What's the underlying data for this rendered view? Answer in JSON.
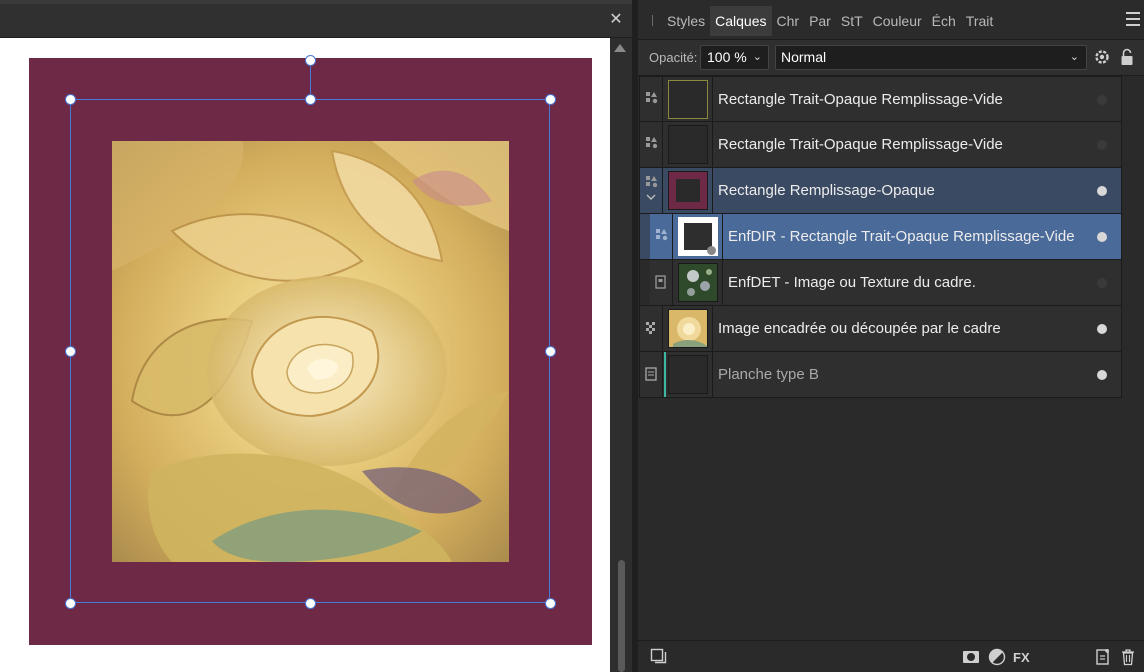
{
  "document": {
    "close_glyph": "✕",
    "frame_color": "#6e2947",
    "selection_color": "#4a78d8"
  },
  "panel": {
    "tabs": [
      {
        "label": "Styles"
      },
      {
        "label": "Calques"
      },
      {
        "label": "Chr"
      },
      {
        "label": "Par"
      },
      {
        "label": "StT"
      },
      {
        "label": "Couleur"
      },
      {
        "label": "Éch"
      },
      {
        "label": "Trait"
      }
    ],
    "active_tab": "Calques",
    "opacity_label": "Opacité:",
    "opacity_value": "100 %",
    "blend_mode": "Normal"
  },
  "layers": [
    {
      "name": "Rectangle Trait-Opaque Remplissage-Vide",
      "icon": "shape-icon",
      "visible": false,
      "selected": false,
      "child": false
    },
    {
      "name": "Rectangle Trait-Opaque Remplissage-Vide",
      "icon": "shape-icon",
      "visible": false,
      "selected": false,
      "child": false
    },
    {
      "name": "Rectangle Remplissage-Opaque",
      "icon": "shape-icon",
      "visible": true,
      "selected": true,
      "child": false,
      "expanded": true
    },
    {
      "name": "EnfDIR - Rectangle Trait-Opaque Remplissage-Vide",
      "icon": "shape-icon",
      "visible": true,
      "selected": true,
      "child": true
    },
    {
      "name": "EnfDET - Image ou Texture du cadre.",
      "icon": "image-icon",
      "visible": false,
      "selected": false,
      "child": true
    },
    {
      "name": "Image encadrée ou découpée par le cadre",
      "icon": "pixel-icon",
      "visible": true,
      "selected": false,
      "child": false
    },
    {
      "name": "Planche type B",
      "icon": "artboard-icon",
      "visible": true,
      "selected": false,
      "child": false
    }
  ]
}
